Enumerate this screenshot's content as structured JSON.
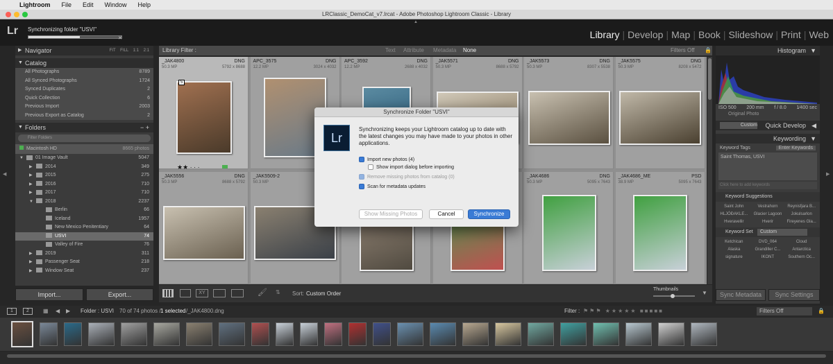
{
  "menubar": {
    "app": "Lightroom",
    "items": [
      "File",
      "Edit",
      "Window",
      "Help"
    ]
  },
  "window": {
    "title": "LRClassic_DemoCat_v7.lrcat - Adobe Photoshop Lightroom Classic - Library"
  },
  "identity": {
    "logo": "Lr",
    "status": "Synchronizing folder \"USVI\"",
    "progress": 0.55
  },
  "modules": [
    "Library",
    "Develop",
    "Map",
    "Book",
    "Slideshow",
    "Print",
    "Web"
  ],
  "navigator": {
    "title": "Navigator",
    "zoom": [
      "FIT",
      "FILL",
      "1:1",
      "2:1"
    ]
  },
  "catalog": {
    "title": "Catalog",
    "items": [
      {
        "label": "All Photographs",
        "count": "8789"
      },
      {
        "label": "All Synced Photographs",
        "count": "1724"
      },
      {
        "label": "Synced Duplicates",
        "count": "2"
      },
      {
        "label": "Quick Collection",
        "count": "6"
      },
      {
        "label": "Previous Import",
        "count": "2003"
      },
      {
        "label": "Previous Export as Catalog",
        "count": "2"
      }
    ]
  },
  "folders": {
    "title": "Folders",
    "filter_placeholder": "Filter Folders",
    "volume": "Macintosh HD",
    "volume_count": "8665 photos",
    "items": [
      {
        "label": "01 Image Vault",
        "count": "5047",
        "level": 0
      },
      {
        "label": "2014",
        "count": "349",
        "level": 1
      },
      {
        "label": "2015",
        "count": "275",
        "level": 1
      },
      {
        "label": "2016",
        "count": "710",
        "level": 1
      },
      {
        "label": "2017",
        "count": "710",
        "level": 1
      },
      {
        "label": "2018",
        "count": "2237",
        "level": 1
      },
      {
        "label": "Berlin",
        "count": "66",
        "level": 2
      },
      {
        "label": "Iceland",
        "count": "1957",
        "level": 2
      },
      {
        "label": "New Mexico Penitentiary",
        "count": "64",
        "level": 2
      },
      {
        "label": "USVI",
        "count": "74",
        "level": 2
      },
      {
        "label": "Valley of Fire",
        "count": "76",
        "level": 2
      },
      {
        "label": "2019",
        "count": "311",
        "level": 1
      },
      {
        "label": "Passenger Seat",
        "count": "218",
        "level": 1
      },
      {
        "label": "Window Seat",
        "count": "237",
        "level": 1
      }
    ]
  },
  "buttons": {
    "import": "Import...",
    "export": "Export..."
  },
  "library_filter": {
    "label": "Library Filter :",
    "tabs": [
      "Text",
      "Attribute",
      "Metadata",
      "None"
    ],
    "preset": "Filters Off"
  },
  "grid": [
    {
      "name": "_JAK4800",
      "ext": "DNG",
      "mp": "50.3 MP",
      "dim": "5792 x 8688",
      "badge": "5"
    },
    {
      "name": "APC_3575",
      "ext": "DNG",
      "mp": "12.2 MP",
      "dim": "3024 x 4032"
    },
    {
      "name": "APC_3592",
      "ext": "DNG",
      "mp": "12.2 MP",
      "dim": "2688 x 4032"
    },
    {
      "name": "_JAK5571",
      "ext": "DNG",
      "mp": "50.3 MP",
      "dim": "8688 x 5792"
    },
    {
      "name": "_JAK5573",
      "ext": "DNG",
      "mp": "50.3 MP",
      "dim": "8307 x 5538"
    },
    {
      "name": "_JAK5575",
      "ext": "DNG",
      "mp": "50.3 MP",
      "dim": "8208 x 5472"
    },
    {
      "name": "_JAK5556",
      "ext": "DNG",
      "mp": "50.3 MP",
      "dim": "8688 x 5792"
    },
    {
      "name": "_JAK5509-2",
      "ext": "DNG",
      "mp": "50.3 MP",
      "dim": ""
    },
    {
      "name": "",
      "ext": "",
      "mp": "",
      "dim": ""
    },
    {
      "name": "",
      "ext": "",
      "mp": "",
      "dim": ""
    },
    {
      "name": "_JAK4686",
      "ext": "DNG",
      "mp": "50.3 MP",
      "dim": "5095 x 7643"
    },
    {
      "name": "_JAK4686_ME",
      "ext": "PSD",
      "mp": "38.9 MP",
      "dim": "5095 x 7643"
    }
  ],
  "toolbar": {
    "sort_label": "Sort:",
    "sort_value": "Custom Order",
    "thumbs_label": "Thumbnails"
  },
  "histogram": {
    "title": "Histogram",
    "iso": "ISO 500",
    "focal": "200 mm",
    "aperture": "f / 8.0",
    "shutter": "1⁄400 sec",
    "original": "Original Photo"
  },
  "quick_develop": {
    "title": "Quick Develop",
    "preset": "Custom"
  },
  "keywording": {
    "title": "Keywording",
    "tags_label": "Keyword Tags",
    "tags_mode": "Enter Keywords",
    "keywords": "Saint Thomas, USVI",
    "add_placeholder": "Click here to add keywords",
    "suggestions_title": "Keyword Suggestions",
    "suggestions": [
      "Saint John",
      "Vestrahorn",
      "Reynisfjara B...",
      "HLJÓÐAKLE...",
      "Glacier Lagoon",
      "Jokulsarlon",
      "Hveravellir",
      "Hverir",
      "Fireyenes Gla..."
    ],
    "set_label": "Keyword Set",
    "set_value": "Custom",
    "set": [
      "Ketchican",
      "DVD_064",
      "Cloud",
      "Alaska",
      "Grandiller C...",
      "Antarctica",
      "signature",
      "IKONT",
      "Southern Oc..."
    ]
  },
  "sync_buttons": {
    "metadata": "Sync Metadata",
    "settings": "Sync Settings"
  },
  "filmstrip": {
    "pages": [
      "1",
      "2"
    ],
    "source": "Folder : USVI",
    "count": "70 of 74 photos /",
    "selected": "1 selected",
    "file": "/_JAK4800.dng",
    "filter_label": "Filter :",
    "filter_value": "Filters Off"
  },
  "dialog": {
    "title": "Synchronize Folder \"USVI\"",
    "message": "Synchronizing keeps your Lightroom catalog up to date with the latest changes you may have made to your photos in other applications.",
    "opt_import": "Import new photos (4)",
    "opt_dialog": "Show import dialog before importing",
    "opt_remove": "Remove missing photos from catalog (0)",
    "opt_scan": "Scan for metadata updates",
    "btn_missing": "Show Missing Photos",
    "btn_cancel": "Cancel",
    "btn_sync": "Synchronize"
  },
  "colors": {
    "accent": "#3a7bd5",
    "panel": "#3b3b3b",
    "grid": "#8f8f8f"
  }
}
